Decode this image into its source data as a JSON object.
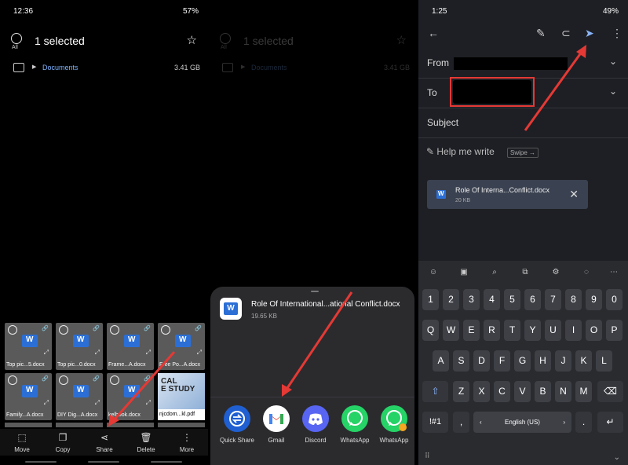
{
  "panel1": {
    "status": {
      "time": "12:36",
      "battery": "57%"
    },
    "header": {
      "selected": "1 selected",
      "all": "All"
    },
    "folder": {
      "name": "Documents",
      "size": "3.41 GB"
    },
    "files": [
      "Top pic...5.docx",
      "Top pic...0.docx",
      "Frame...A.docx",
      "Free Po...A.docx",
      "Family...A.docx",
      "DIY Dig...A.docx",
      "kelbook.docx",
      "njcdom...kl.pdf"
    ],
    "pdf_thumb_text": "CAL\nE STUDY",
    "bottom_bar": [
      "Move",
      "Copy",
      "Share",
      "Delete",
      "More"
    ]
  },
  "panel2": {
    "header": {
      "selected": "1 selected",
      "all": "All"
    },
    "folder": {
      "name": "Documents",
      "size": "3.41 GB"
    },
    "share_file": {
      "name": "Role Of International...ational Conflict.docx",
      "size": "19.65 KB"
    },
    "apps": [
      "Quick Share",
      "Gmail",
      "Discord",
      "WhatsApp",
      "WhatsApp"
    ]
  },
  "panel3": {
    "status": {
      "time": "1:25",
      "battery": "49%"
    },
    "fields": {
      "from": "From",
      "to": "To",
      "subject": "Subject"
    },
    "help": "Help me write",
    "swipe": "Swipe →",
    "attachment": {
      "name": "Role Of Interna...Conflict.docx",
      "size": "20 KB"
    },
    "keyboard": {
      "row1": [
        "1",
        "2",
        "3",
        "4",
        "5",
        "6",
        "7",
        "8",
        "9",
        "0"
      ],
      "row2": [
        "Q",
        "W",
        "E",
        "R",
        "T",
        "Y",
        "U",
        "I",
        "O",
        "P"
      ],
      "row3": [
        "A",
        "S",
        "D",
        "F",
        "G",
        "H",
        "J",
        "K",
        "L"
      ],
      "row4": [
        "Z",
        "X",
        "C",
        "V",
        "B",
        "N",
        "M"
      ],
      "sym": "!#1",
      "comma": ",",
      "space": "English (US)",
      "period": "."
    }
  },
  "colors": {
    "accent_red": "#e53935",
    "link_blue": "#7ab3ff",
    "send_blue": "#8ab4f8"
  }
}
